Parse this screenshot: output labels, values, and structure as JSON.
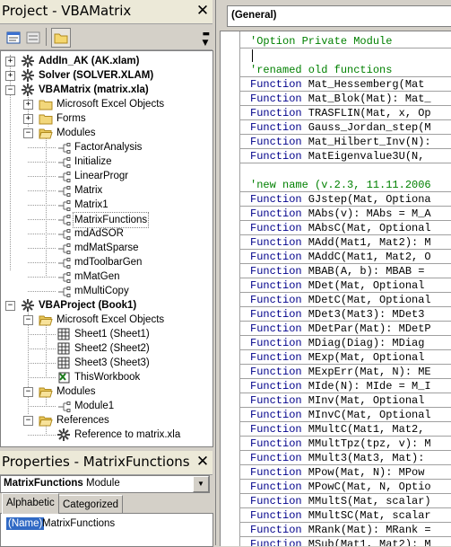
{
  "project": {
    "title": "Project - VBAMatrix",
    "tree": [
      {
        "label": "AddIn_AK (AK.xlam)",
        "bold": true,
        "icon": "vba-project-icon",
        "expander": "+"
      },
      {
        "label": "Solver (SOLVER.XLAM)",
        "bold": true,
        "icon": "vba-project-icon",
        "expander": "+"
      },
      {
        "label": "VBAMatrix (matrix.xla)",
        "bold": true,
        "icon": "vba-project-icon",
        "expander": "-"
      },
      {
        "label": "Microsoft Excel Objects",
        "icon": "folder-icon",
        "expander": "+"
      },
      {
        "label": "Forms",
        "icon": "folder-icon",
        "expander": "+"
      },
      {
        "label": "Modules",
        "icon": "open-folder-icon",
        "expander": "-"
      },
      {
        "label": "FactorAnalysis",
        "icon": "module-icon"
      },
      {
        "label": "Initialize",
        "icon": "module-icon"
      },
      {
        "label": "LinearProgr",
        "icon": "module-icon"
      },
      {
        "label": "Matrix",
        "icon": "module-icon"
      },
      {
        "label": "Matrix1",
        "icon": "module-icon"
      },
      {
        "label": "MatrixFunctions",
        "icon": "module-icon",
        "selected": true
      },
      {
        "label": "mdAdSOR",
        "icon": "module-icon"
      },
      {
        "label": "mdMatSparse",
        "icon": "module-icon"
      },
      {
        "label": "mdToolbarGen",
        "icon": "module-icon"
      },
      {
        "label": "mMatGen",
        "icon": "module-icon"
      },
      {
        "label": "mMultiCopy",
        "icon": "module-icon"
      },
      {
        "label": "VBAProject (Book1)",
        "bold": true,
        "icon": "vba-project-icon",
        "expander": "-"
      },
      {
        "label": "Microsoft Excel Objects",
        "icon": "open-folder-icon",
        "expander": "-"
      },
      {
        "label": "Sheet1 (Sheet1)",
        "icon": "sheet-icon"
      },
      {
        "label": "Sheet2 (Sheet2)",
        "icon": "sheet-icon"
      },
      {
        "label": "Sheet3 (Sheet3)",
        "icon": "sheet-icon"
      },
      {
        "label": "ThisWorkbook",
        "icon": "workbook-icon"
      },
      {
        "label": "Modules",
        "icon": "open-folder-icon",
        "expander": "-"
      },
      {
        "label": "Module1",
        "icon": "module-icon"
      },
      {
        "label": "References",
        "icon": "open-folder-icon",
        "expander": "-"
      },
      {
        "label": "Reference to matrix.xla",
        "icon": "reference-icon"
      }
    ]
  },
  "properties": {
    "title": "Properties - MatrixFunctions",
    "object_name": "MatrixFunctions",
    "object_type": "Module",
    "tabs": [
      "Alphabetic",
      "Categorized"
    ],
    "active_tab": "Alphabetic",
    "row_name": "(Name)",
    "row_value": "MatrixFunctions"
  },
  "code_window": {
    "object_combo": "(General)",
    "lines": [
      {
        "kind": "comment",
        "text": "'Option Private Module"
      },
      {
        "kind": "blank",
        "text": ""
      },
      {
        "kind": "comment",
        "text": "'renamed old functions"
      },
      {
        "kind": "code",
        "kw": "Function",
        "text": " Mat_Hessemberg(Mat"
      },
      {
        "kind": "code",
        "kw": "Function",
        "text": " Mat_Blok(Mat): Mat_"
      },
      {
        "kind": "code",
        "kw": "Function",
        "text": " TRASFLIN(Mat, x, Op"
      },
      {
        "kind": "code",
        "kw": "Function",
        "text": " Gauss_Jordan_step(M"
      },
      {
        "kind": "code",
        "kw": "Function",
        "text": " Mat_Hilbert_Inv(N):"
      },
      {
        "kind": "code",
        "kw": "Function",
        "text": " MatEigenvalue3U(N, "
      },
      {
        "kind": "blank",
        "text": ""
      },
      {
        "kind": "comment",
        "text": "'new name (v.2.3, 11.11.2006"
      },
      {
        "kind": "code",
        "kw": "Function",
        "text": " GJstep(Mat, Optiona"
      },
      {
        "kind": "code",
        "kw": "Function",
        "text": " MAbs(v): MAbs = M_A"
      },
      {
        "kind": "code",
        "kw": "Function",
        "text": " MAbsC(Mat, Optional"
      },
      {
        "kind": "code",
        "kw": "Function",
        "text": " MAdd(Mat1, Mat2): M"
      },
      {
        "kind": "code",
        "kw": "Function",
        "text": " MAddC(Mat1, Mat2, O"
      },
      {
        "kind": "code",
        "kw": "Function",
        "text": " MBAB(A, b): MBAB = "
      },
      {
        "kind": "code",
        "kw": "Function",
        "text": " MDet(Mat, Optional "
      },
      {
        "kind": "code",
        "kw": "Function",
        "text": " MDetC(Mat, Optional"
      },
      {
        "kind": "code",
        "kw": "Function",
        "text": " MDet3(Mat3): MDet3 "
      },
      {
        "kind": "code",
        "kw": "Function",
        "text": " MDetPar(Mat): MDetP"
      },
      {
        "kind": "code",
        "kw": "Function",
        "text": " MDiag(Diag): MDiag "
      },
      {
        "kind": "code",
        "kw": "Function",
        "text": " MExp(Mat, Optional "
      },
      {
        "kind": "code",
        "kw": "Function",
        "text": " MExpErr(Mat, N): ME"
      },
      {
        "kind": "code",
        "kw": "Function",
        "text": " MIde(N): MIde = M_I"
      },
      {
        "kind": "code",
        "kw": "Function",
        "text": " MInv(Mat, Optional "
      },
      {
        "kind": "code",
        "kw": "Function",
        "text": " MInvC(Mat, Optional"
      },
      {
        "kind": "code",
        "kw": "Function",
        "text": " MMultC(Mat1, Mat2, "
      },
      {
        "kind": "code",
        "kw": "Function",
        "text": " MMultTpz(tpz, v): M"
      },
      {
        "kind": "code",
        "kw": "Function",
        "text": " MMult3(Mat3, Mat): "
      },
      {
        "kind": "code",
        "kw": "Function",
        "text": " MPow(Mat, N): MPow "
      },
      {
        "kind": "code",
        "kw": "Function",
        "text": " MPowC(Mat, N, Optio"
      },
      {
        "kind": "code",
        "kw": "Function",
        "text": " MMultS(Mat, scalar)"
      },
      {
        "kind": "code",
        "kw": "Function",
        "text": " MMultSC(Mat, scalar"
      },
      {
        "kind": "code",
        "kw": "Function",
        "text": " MRank(Mat): MRank ="
      },
      {
        "kind": "code",
        "kw": "Function",
        "text": " MSub(Mat1, Mat2): M"
      }
    ]
  }
}
